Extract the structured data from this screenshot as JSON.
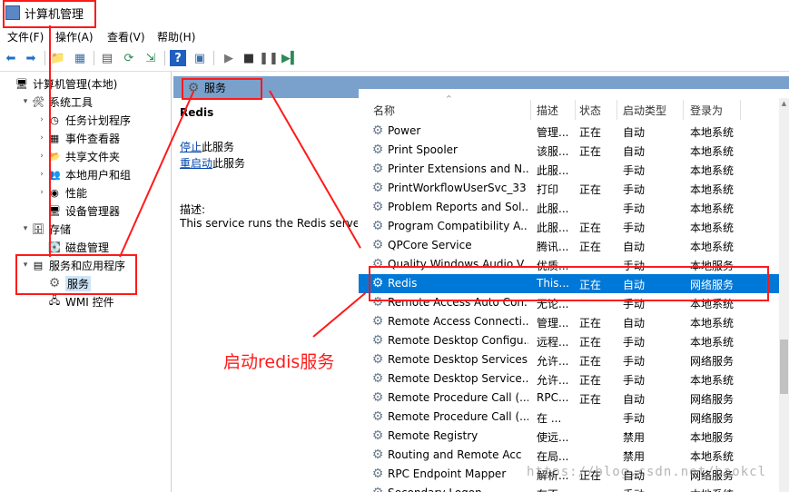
{
  "window": {
    "title": "计算机管理"
  },
  "menu": [
    "文件(F)",
    "操作(A)",
    "查看(V)",
    "帮助(H)"
  ],
  "tree": [
    {
      "label": "计算机管理(本地)",
      "indent": 0,
      "arrow": "",
      "icon": "computer-icon"
    },
    {
      "label": "系统工具",
      "indent": 1,
      "arrow": "▾",
      "icon": "tools-icon"
    },
    {
      "label": "任务计划程序",
      "indent": 2,
      "arrow": "›",
      "icon": "clock-icon"
    },
    {
      "label": "事件查看器",
      "indent": 2,
      "arrow": "›",
      "icon": "event-viewer-icon"
    },
    {
      "label": "共享文件夹",
      "indent": 2,
      "arrow": "›",
      "icon": "shared-folder-icon"
    },
    {
      "label": "本地用户和组",
      "indent": 2,
      "arrow": "›",
      "icon": "users-icon"
    },
    {
      "label": "性能",
      "indent": 2,
      "arrow": "›",
      "icon": "performance-icon"
    },
    {
      "label": "设备管理器",
      "indent": 2,
      "arrow": "",
      "icon": "device-manager-icon"
    },
    {
      "label": "存储",
      "indent": 1,
      "arrow": "▾",
      "icon": "storage-icon"
    },
    {
      "label": "磁盘管理",
      "indent": 2,
      "arrow": "",
      "icon": "disk-icon"
    },
    {
      "label": "服务和应用程序",
      "indent": 1,
      "arrow": "▾",
      "icon": "services-apps-icon"
    },
    {
      "label": "服务",
      "indent": 2,
      "arrow": "",
      "icon": "gear-icon",
      "selected": true
    },
    {
      "label": "WMI 控件",
      "indent": 2,
      "arrow": "",
      "icon": "wmi-icon"
    }
  ],
  "band": {
    "label": "服务"
  },
  "detail": {
    "title": "Redis",
    "stop_link": "停止",
    "stop_suffix": "此服务",
    "restart_link": "重启动",
    "restart_suffix": "此服务",
    "desc_label": "描述:",
    "desc_text": "This service runs the Redis server"
  },
  "columns": [
    "名称",
    "描述",
    "状态",
    "启动类型",
    "登录为"
  ],
  "services": [
    {
      "name": "Power",
      "desc": "管理...",
      "status": "正在",
      "startup": "自动",
      "logon": "本地系统"
    },
    {
      "name": "Print Spooler",
      "desc": "该服...",
      "status": "正在",
      "startup": "自动",
      "logon": "本地系统"
    },
    {
      "name": "Printer Extensions and N...",
      "desc": "此服...",
      "status": "",
      "startup": "手动",
      "logon": "本地系统"
    },
    {
      "name": "PrintWorkflowUserSvc_33",
      "desc": "打印",
      "status": "正在",
      "startup": "手动",
      "logon": "本地系统"
    },
    {
      "name": "Problem Reports and Sol...",
      "desc": "此服...",
      "status": "",
      "startup": "手动",
      "logon": "本地系统"
    },
    {
      "name": "Program Compatibility A...",
      "desc": "此服...",
      "status": "正在",
      "startup": "手动",
      "logon": "本地系统"
    },
    {
      "name": "QPCore Service",
      "desc": "腾讯...",
      "status": "正在",
      "startup": "自动",
      "logon": "本地系统"
    },
    {
      "name": "Quality Windows Audio V...",
      "desc": "优质...",
      "status": "",
      "startup": "手动",
      "logon": "本地服务"
    },
    {
      "name": "Redis",
      "desc": "This...",
      "status": "正在",
      "startup": "自动",
      "logon": "网络服务",
      "selected": true
    },
    {
      "name": "Remote Access Auto Con...",
      "desc": "无论...",
      "status": "",
      "startup": "手动",
      "logon": "本地系统"
    },
    {
      "name": "Remote Access Connecti...",
      "desc": "管理...",
      "status": "正在",
      "startup": "自动",
      "logon": "本地系统"
    },
    {
      "name": "Remote Desktop Configu...",
      "desc": "远程...",
      "status": "正在",
      "startup": "手动",
      "logon": "本地系统"
    },
    {
      "name": "Remote Desktop Services",
      "desc": "允许...",
      "status": "正在",
      "startup": "手动",
      "logon": "网络服务"
    },
    {
      "name": "Remote Desktop Service...",
      "desc": "允许...",
      "status": "正在",
      "startup": "手动",
      "logon": "本地系统"
    },
    {
      "name": "Remote Procedure Call (...",
      "desc": "RPC...",
      "status": "正在",
      "startup": "自动",
      "logon": "网络服务"
    },
    {
      "name": "Remote Procedure Call (...",
      "desc": "在 ...",
      "status": "",
      "startup": "手动",
      "logon": "网络服务"
    },
    {
      "name": "Remote Registry",
      "desc": "使远...",
      "status": "",
      "startup": "禁用",
      "logon": "本地服务"
    },
    {
      "name": "Routing and Remote Acc",
      "desc": "在局...",
      "status": "",
      "startup": "禁用",
      "logon": "本地系统"
    },
    {
      "name": "RPC Endpoint Mapper",
      "desc": "解析...",
      "status": "正在",
      "startup": "自动",
      "logon": "网络服务"
    },
    {
      "name": "Secondary Logon",
      "desc": "在不...",
      "status": "",
      "startup": "手动",
      "logon": "本地系统"
    }
  ],
  "annotation": {
    "text": "启动redis服务",
    "color": "#ff1a1a"
  },
  "watermark": "https://blog.csdn.net/haokcl"
}
